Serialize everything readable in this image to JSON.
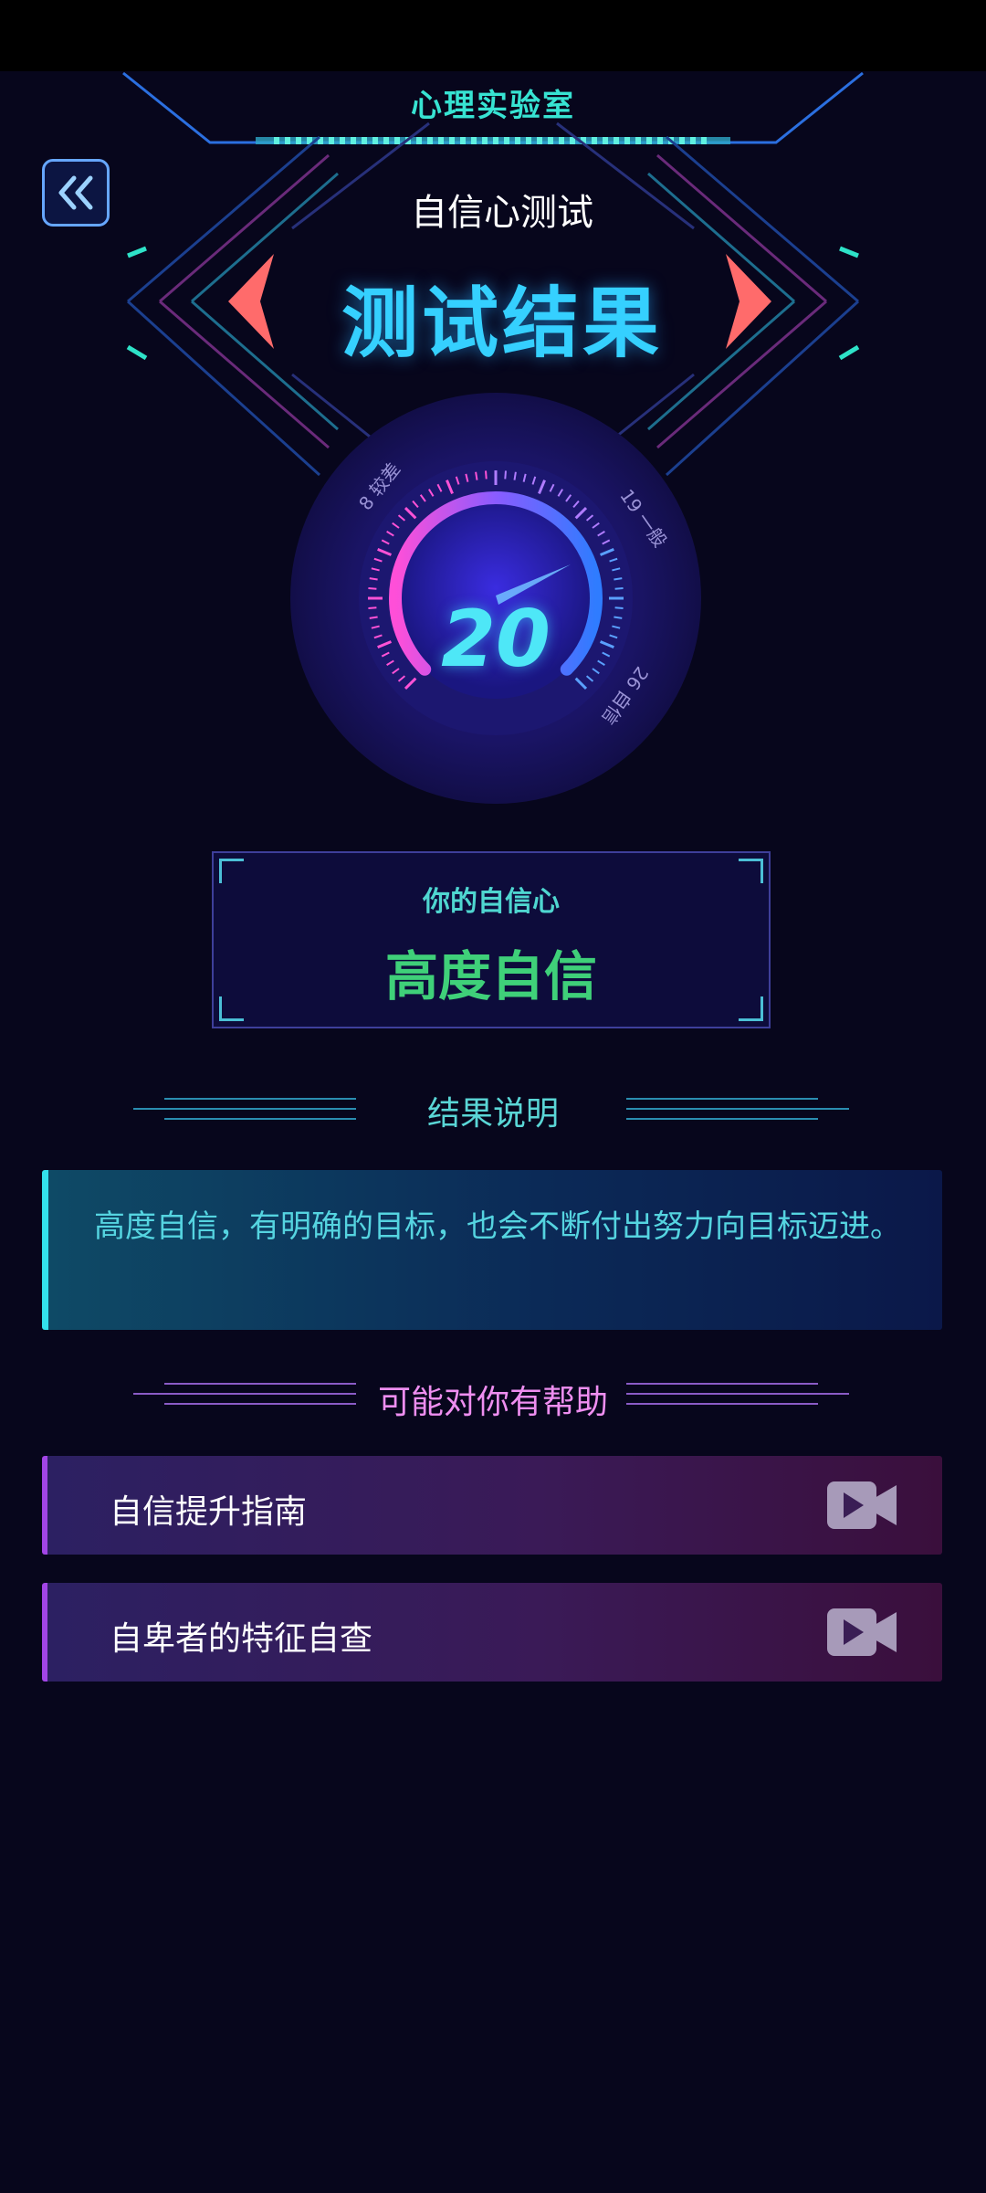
{
  "header": {
    "lab_title": "心理实验室",
    "subtitle": "自信心测试",
    "main_title": "测试结果"
  },
  "gauge": {
    "score": "20",
    "ticks": [
      {
        "value": "8",
        "label": "较差"
      },
      {
        "value": "19",
        "label": "一般"
      },
      {
        "value": "26",
        "label": "自信"
      }
    ]
  },
  "result": {
    "label": "你的自信心",
    "value": "高度自信"
  },
  "explanation": {
    "title": "结果说明",
    "text": "高度自信，有明确的目标，也会不断付出努力向目标迈进。"
  },
  "help": {
    "title": "可能对你有帮助",
    "items": [
      {
        "label": "自信提升指南",
        "icon": "video-camera-icon"
      },
      {
        "label": "自卑者的特征自查",
        "icon": "video-camera-icon"
      }
    ]
  },
  "colors": {
    "background": "#07061c",
    "accent_cyan": "#35d0ff",
    "result_green": "#3fd079",
    "help_purple": "#a245e6"
  }
}
